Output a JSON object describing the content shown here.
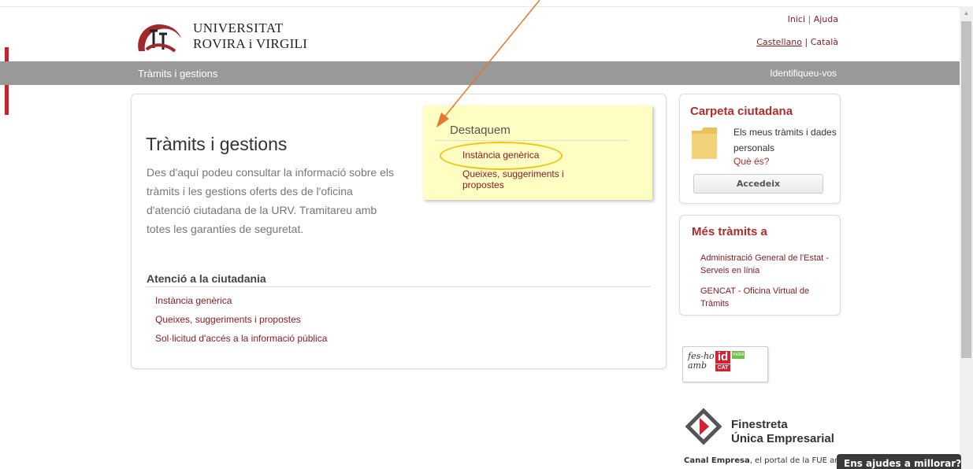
{
  "header": {
    "logo_line1": "UNIVERSITAT",
    "logo_line2": "ROVIRA i VIRGILI",
    "top_links": [
      "Inici",
      "Ajuda"
    ],
    "languages": [
      "Castellano",
      "Català"
    ]
  },
  "nav_bar": {
    "title": "Tràmits i gestions",
    "login": "Identifiqueu-vos"
  },
  "main": {
    "title": "Tràmits i gestions",
    "description": "Des d'aquí podeu consultar la informació sobre els tràmits i les gestions oferts des de l'oficina d'atenció ciutadana de la URV. Tramitareu amb totes les garanties de seguretat.",
    "section_title": "Atenció a la ciutadania",
    "section_links": [
      "Instància genèrica",
      "Queixes, suggeriments i propostes",
      "Sol·licitud d'accés a la informació pública"
    ]
  },
  "highlights": {
    "title": "Destaquem",
    "links": [
      "Instància genèrica",
      "Queixes, suggeriments i propostes"
    ]
  },
  "carpeta": {
    "title": "Carpeta ciutadana",
    "text": "Els meus tràmits i dades personals",
    "link": "Què és?",
    "button": "Accedeix"
  },
  "mes_tramits": {
    "title": "Més tràmits a",
    "links": [
      "Administració General de l'Estat - Serveis en línia",
      "GENCAT - Oficina Virtual de Tràmits"
    ]
  },
  "idcat_badge": {
    "text_line1": "fes-ho",
    "text_line2": "amb",
    "id": "id",
    "cat": "CAT",
    "mobile": "mòbil"
  },
  "finestreta": {
    "line1": "Finestreta",
    "line2": "Única Empresarial",
    "footer_bold": "Canal Empresa",
    "footer_rest": ", el portal de la FUE am"
  },
  "help_tab": "Ens ajudes a millorar?",
  "colors": {
    "brand_red": "#b22b2b",
    "link_red": "#8a1c22",
    "bar_gray": "#999999",
    "note_yellow": "#fefdc2",
    "annotation_orange": "#e8762c",
    "annotation_yellow": "#f1c40f"
  }
}
